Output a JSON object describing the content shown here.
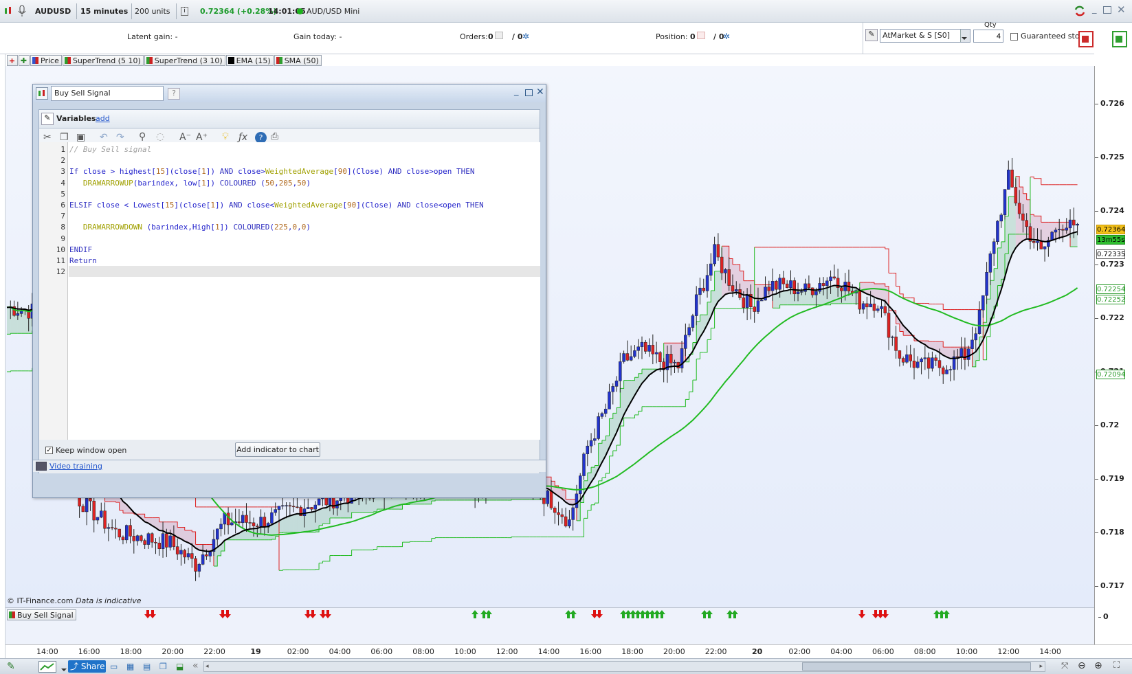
{
  "toolbar": {
    "instrument": "AUDUSD",
    "timeframe": "15 minutes",
    "units": "200 units",
    "price": "0.72364 (+0.28%)",
    "time": "14:01:05",
    "market": "AUD/USD Mini"
  },
  "info": {
    "latent_gain": "Latent gain:  -",
    "gain_today": "Gain today:  -",
    "orders_label": "Orders:",
    "orders_a": "0",
    "orders_b": "/ 0",
    "position_label": "Position:",
    "position_a": "0",
    "position_b": "/ 0",
    "order_type": "AtMarket & S [S0]",
    "qty_label": "Qty",
    "qty_value": "4",
    "guaranteed_stop": "Guaranteed stop"
  },
  "legend": [
    {
      "label": "Price",
      "color": "#3366cc"
    },
    {
      "label": "SuperTrend (5 10)",
      "color": "#cc2222"
    },
    {
      "label": "SuperTrend (3 10)",
      "color": "#cc2222"
    },
    {
      "label": "EMA (15)",
      "color": "#000000"
    },
    {
      "label": "SMA (50)",
      "color": "#22aa22"
    }
  ],
  "dialog": {
    "title": "Buy Sell Signal",
    "variables": "Variables",
    "add": "add",
    "keep_open": "Keep window open",
    "add_indicator": "Add indicator to chart",
    "video_training": "Video training"
  },
  "code_lines": [
    "// Buy Sell signal",
    "",
    "If close > highest[15](close[1]) AND close>WeightedAverage[90](Close) AND close>open THEN",
    "   DRAWARROWUP(barindex, low[1]) COLOURED (50,205,50)",
    "",
    "ELSIF close < Lowest[15](close[1]) AND close<WeightedAverage[90](Close) AND close<open THEN",
    "",
    "   DRAWARROWDOWN (barindex,High[1]) COLOURED(225,0,0)",
    "",
    "ENDIF",
    "Return",
    ""
  ],
  "axis": {
    "ticks": [
      "0.726",
      "0.725",
      "0.724",
      "0.723",
      "0.722",
      "0.721",
      "0.72",
      "0.719",
      "0.718",
      "0.717"
    ],
    "price_tag": "0.72364",
    "countdown": "13m55s",
    "tag_2335": "0.72335",
    "tag_2254": "0.72254",
    "tag_2252": "0.72252",
    "tag_2094": "0.72094",
    "sub_zero": "0"
  },
  "time_labels": [
    "14:00",
    "16:00",
    "18:00",
    "20:00",
    "22:00",
    "19",
    "02:00",
    "04:00",
    "06:00",
    "08:00",
    "10:00",
    "12:00",
    "14:00",
    "16:00",
    "18:00",
    "20:00",
    "22:00",
    "20",
    "02:00",
    "04:00",
    "06:00",
    "08:00",
    "10:00",
    "12:00",
    "14:00"
  ],
  "watermark": "© IT-Finance.com",
  "watermark_note": "Data is indicative",
  "sub_indicator": "Buy Sell Signal",
  "bottom": {
    "share": "Share"
  },
  "chart_data": {
    "type": "candlestick",
    "instrument": "AUDUSD",
    "ylim": [
      0.7166,
      0.7267
    ],
    "last_price": 0.72364,
    "ema15_last": 0.72335,
    "sma50_last": 0.72252,
    "supertrend_last": [
      0.72254,
      0.72094
    ],
    "signals": {
      "down_arrows_at": [
        "19:30",
        "23:15",
        "03:30",
        "03:45",
        "04:00",
        "04:15",
        "17:00",
        "17:15",
        "06:45",
        "07:15",
        "07:30",
        "07:45"
      ],
      "up_arrows_at": [
        "11:30",
        "11:45",
        "12:00",
        "16:00",
        "16:15",
        "19:30",
        "19:45",
        "20:00",
        "20:15",
        "20:30",
        "20:45",
        "21:00",
        "21:15",
        "21:30",
        "23:00",
        "23:15",
        "00:15",
        "00:30",
        "10:15",
        "10:30",
        "10:45"
      ]
    }
  }
}
